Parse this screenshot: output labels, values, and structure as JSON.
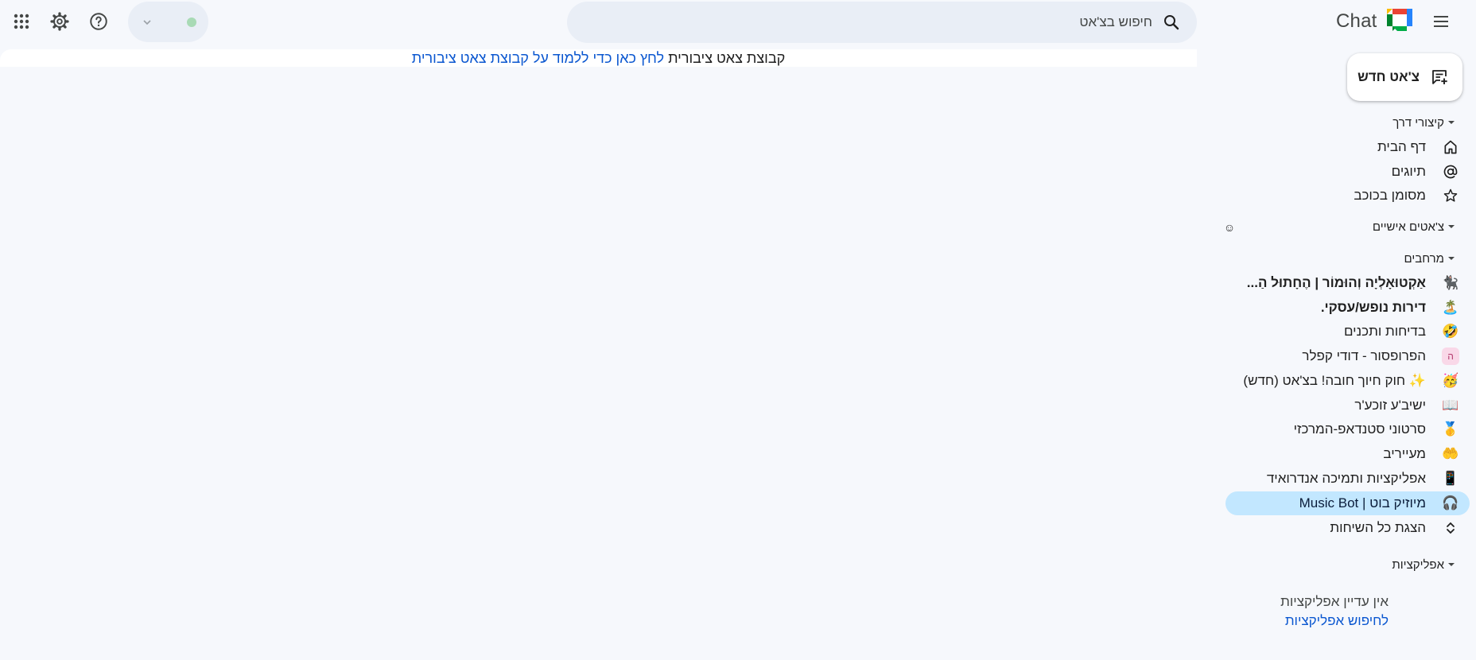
{
  "app": {
    "logo_text": "Chat",
    "search_placeholder": "חיפוש בצ'אט"
  },
  "banner": {
    "text": "קבוצת צאט ציבורית",
    "link_text": "לחץ כאן כדי ללמוד על קבוצת צאט ציבורית"
  },
  "sidebar": {
    "new_chat_label": "צ'אט חדש",
    "shortcuts": {
      "header": "קיצורי דרך",
      "items": [
        {
          "label": "דף הבית",
          "icon": "home-icon"
        },
        {
          "label": "תיוגים",
          "icon": "at-sign-icon"
        },
        {
          "label": "מסומן בכוכב",
          "icon": "star-icon"
        }
      ]
    },
    "direct_messages": {
      "header": "צ'אטים אישיים",
      "emoji_icon": "☺"
    },
    "spaces": {
      "header": "מרחבים",
      "items": [
        {
          "label": "אַקְטוּאָלְיָה וְהוּמוֹר | הֶחָתוּל הַ...",
          "icon": "🐈‍⬛",
          "bold": true
        },
        {
          "label": "דירות נופש/עסקי.",
          "icon": "🏝️",
          "bold": true
        },
        {
          "label": "בדיחות ותכנים",
          "icon": "🤣",
          "bold": false
        },
        {
          "label": "הפרופסור - דודי קפלר",
          "icon": "ה",
          "bold": false,
          "letter": true
        },
        {
          "label": "✨ חוק חיוך חובה! בצ'אט (חדש)",
          "icon": "🥳",
          "bold": false
        },
        {
          "label": "ישיב'ע זוכע'ר",
          "icon": "📖",
          "bold": false
        },
        {
          "label": "סרטוני סטנדאפ-המרכזי",
          "icon": "🥇",
          "bold": false
        },
        {
          "label": "מעייריב",
          "icon": "🤲",
          "bold": false
        },
        {
          "label": "אפליקציות ותמיכה אנדרואיד",
          "icon": "📱",
          "bold": false
        },
        {
          "label": "מיוזיק בוט | Music Bot",
          "icon": "🎧",
          "bold": false,
          "selected": true
        }
      ],
      "show_all_label": "הצגת כל השיחות"
    },
    "apps": {
      "header": "אפליקציות",
      "empty_text": "אין עדיין אפליקציות",
      "find_link": "לחיפוש אפליקציות"
    }
  },
  "colors": {
    "background": "#f6f8fc",
    "search_bg": "#e9eef6",
    "selected_bg": "#c2e7ff",
    "link": "#0b57d0",
    "status_dot": "#a8dab5"
  }
}
